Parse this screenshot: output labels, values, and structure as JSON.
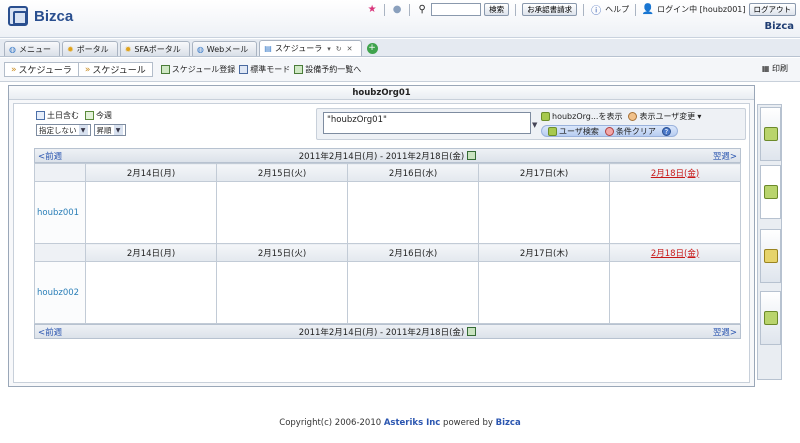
{
  "header": {
    "logo_text": "Bizca",
    "app_name": "Bizca",
    "search_button": "検索",
    "approval_button": "お承認書請求",
    "help_label": "ヘルプ",
    "login_text": "ログイン中 [houbz001]",
    "logout_button": "ログアウト"
  },
  "tabs": [
    {
      "label": "メニュー"
    },
    {
      "label": "ポータル"
    },
    {
      "label": "SFAポータル"
    },
    {
      "label": "Webメール"
    },
    {
      "label": "スケジューラ"
    }
  ],
  "subbar": {
    "crumb1": "スケジューラ",
    "crumb2": "スケジュール",
    "link_register": "スケジュール登録",
    "link_standard": "標準モード",
    "link_facility": "設備予約一覧へ",
    "print": "印刷"
  },
  "panel": {
    "title": "houbzOrg01"
  },
  "controls": {
    "include_weekend": "土日含む",
    "this_week": "今週",
    "select_filter": "指定しない",
    "select_order": "昇順",
    "org_value": "\"houbzOrg01\"",
    "org_display": "houbzOrg...を表示",
    "change_user": "表示ユーザ変更",
    "user_search": "ユーザ検索",
    "clear_conditions": "条件クリア"
  },
  "schedule": {
    "prev": "<前週",
    "next": "翌週>",
    "range": "2011年2月14日(月) - 2011年2月18日(金)",
    "days": [
      "2月14日(月)",
      "2月15日(火)",
      "2月16日(水)",
      "2月17日(木)",
      "2月18日(金)"
    ],
    "users": [
      "houbz001",
      "houbz002"
    ]
  },
  "footer": {
    "prefix": "Copyright(c) 2006-2010 ",
    "company": "Asteriks Inc",
    "middle": " powered by ",
    "product": "Bizca"
  }
}
